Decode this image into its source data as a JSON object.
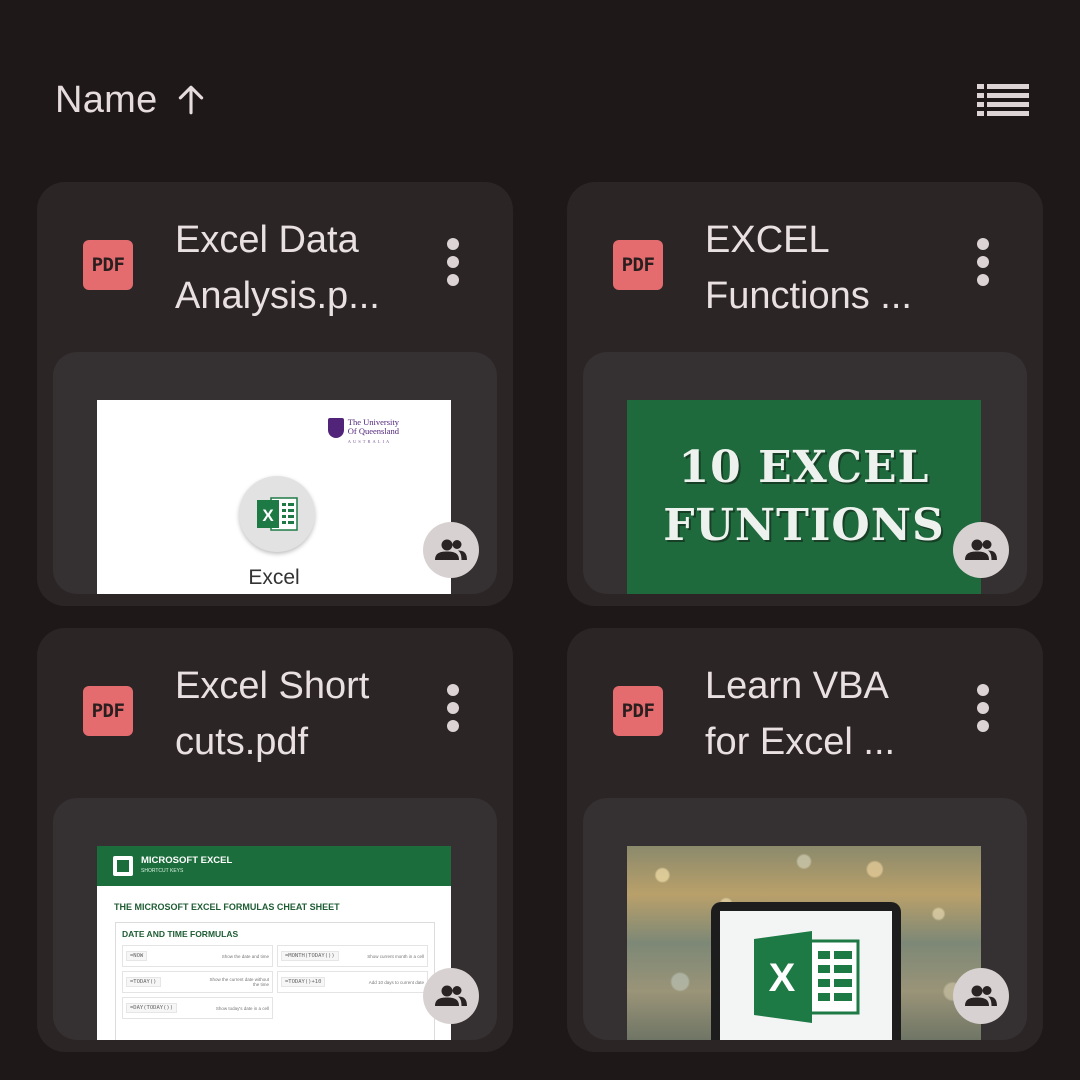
{
  "sort": {
    "label": "Name",
    "direction_icon": "arrow-up-icon"
  },
  "view_toggle": {
    "icon": "list-view-icon"
  },
  "colors": {
    "background": "#1e1819",
    "card": "#2b2526",
    "pdf_badge": "#e46b6e"
  },
  "files": [
    {
      "type_badge": "PDF",
      "title": "Excel Data\nAnalysis.p...",
      "shared": true,
      "thumbnail": {
        "university_name": "The University\nOf Queensland",
        "university_country": "AUSTRALIA",
        "caption": "Excel"
      }
    },
    {
      "type_badge": "PDF",
      "title": "EXCEL\nFunctions ...",
      "shared": true,
      "thumbnail": {
        "line1": "10 EXCEL",
        "line2": "FUNTIONS"
      }
    },
    {
      "type_badge": "PDF",
      "title": "Excel Short\ncuts.pdf",
      "shared": true,
      "thumbnail": {
        "brand": "MICROSOFT EXCEL",
        "brand_sub": "SHORTCUT KEYS",
        "heading": "THE MICROSOFT EXCEL FORMULAS CHEAT SHEET",
        "section": "DATE AND TIME FORMULAS",
        "rows": [
          {
            "code": "=NOW",
            "desc": "Show the date and time"
          },
          {
            "code": "=MONTH(TODAY())",
            "desc": "Show current month in a cell"
          },
          {
            "code": "=TODAY()",
            "desc": "Show the current date without the time"
          },
          {
            "code": "=TODAY()+10",
            "desc": "Add 10 days to current date"
          },
          {
            "code": "=DAY(TODAY())",
            "desc": "Show today's date in a cell"
          }
        ]
      }
    },
    {
      "type_badge": "PDF",
      "title": "Learn VBA\nfor Excel ...",
      "shared": true,
      "thumbnail": {
        "logo_letter": "X"
      }
    }
  ]
}
